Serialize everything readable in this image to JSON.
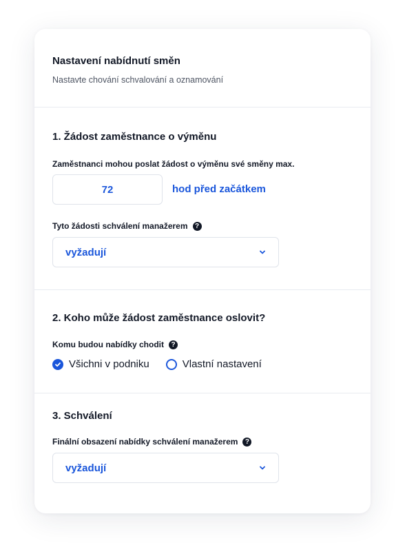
{
  "header": {
    "title": "Nastavení nabídnutí směn",
    "subtitle": "Nastavte chování schvalování a oznamování"
  },
  "section1": {
    "title": "1. Žádost zaměstnance o výměnu",
    "hours_label": "Zaměstnanci mohou poslat žádost o výměnu své směny max.",
    "hours_value": "72",
    "hours_unit": "hod před začátkem",
    "approval_label": "Tyto žádosti schválení manažerem",
    "approval_value": "vyžadují"
  },
  "section2": {
    "title": "2. Koho může žádost zaměstnance oslovit?",
    "recipients_label": "Komu budou nabídky chodit",
    "options": [
      {
        "label": "Všichni v podniku",
        "selected": true
      },
      {
        "label": "Vlastní nastavení",
        "selected": false
      }
    ]
  },
  "section3": {
    "title": "3. Schválení",
    "final_label": "Finální obsazení nabídky schválení manažerem",
    "final_value": "vyžadují"
  },
  "colors": {
    "accent": "#1a56db",
    "text": "#121826",
    "muted": "#4e5563",
    "border": "#dfe3ea"
  },
  "icons": {
    "help": "question-circle-icon",
    "dropdown": "chevron-down-icon",
    "checked": "check-circle-icon"
  }
}
